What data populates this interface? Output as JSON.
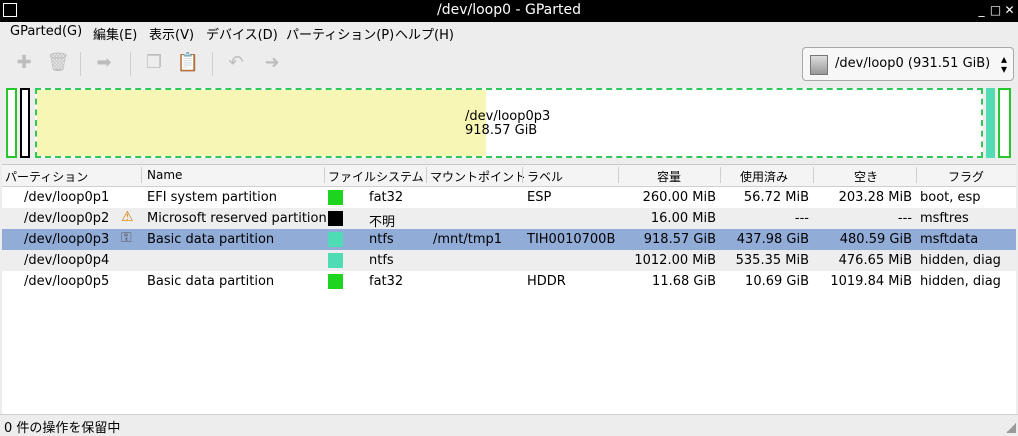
{
  "window": {
    "title": "/dev/loop0 - GParted"
  },
  "menu": [
    "GParted(G)",
    "編集(E)",
    "表示(V)",
    "デバイス(D)",
    "パーティション(P)",
    "ヘルプ(H)"
  ],
  "device_selector": {
    "value": "/dev/loop0  (931.51 GiB)"
  },
  "disk_map": {
    "label_name": "/dev/loop0p3",
    "label_size": "918.57 GiB"
  },
  "columns": [
    "パーティション",
    "Name",
    "ファイルシステム",
    "マウントポイント",
    "ラベル",
    "容量",
    "使用済み",
    "空き",
    "フラグ"
  ],
  "rows": [
    {
      "partition": "/dev/loop0p1",
      "name": "EFI system partition",
      "fs": "fat32",
      "mount": "",
      "label": "ESP",
      "size": "260.00 MiB",
      "used": "56.72 MiB",
      "free": "203.28 MiB",
      "flags": "boot, esp",
      "color": "#1fd41f",
      "icon": ""
    },
    {
      "partition": "/dev/loop0p2",
      "name": "Microsoft reserved partition",
      "fs": "不明",
      "mount": "",
      "label": "",
      "size": "16.00 MiB",
      "used": "---",
      "free": "---",
      "flags": "msftres",
      "color": "#000000",
      "icon": "warning-icon"
    },
    {
      "partition": "/dev/loop0p3",
      "name": "Basic data partition",
      "fs": "ntfs",
      "mount": "/mnt/tmp1",
      "label": "TIH0010700B",
      "size": "918.57 GiB",
      "used": "437.98 GiB",
      "free": "480.59 GiB",
      "flags": "msftdata",
      "color": "#4fdcb4",
      "icon": "key-icon"
    },
    {
      "partition": "/dev/loop0p4",
      "name": "",
      "fs": "ntfs",
      "mount": "",
      "label": "",
      "size": "1012.00 MiB",
      "used": "535.35 MiB",
      "free": "476.65 MiB",
      "flags": "hidden, diag",
      "color": "#4fdcb4",
      "icon": ""
    },
    {
      "partition": "/dev/loop0p5",
      "name": "Basic data partition",
      "fs": "fat32",
      "mount": "",
      "label": "HDDR",
      "size": "11.68 GiB",
      "used": "10.69 GiB",
      "free": "1019.84 MiB",
      "flags": "hidden, diag",
      "color": "#1fd41f",
      "icon": ""
    }
  ],
  "status": "0 件の操作を保留中"
}
